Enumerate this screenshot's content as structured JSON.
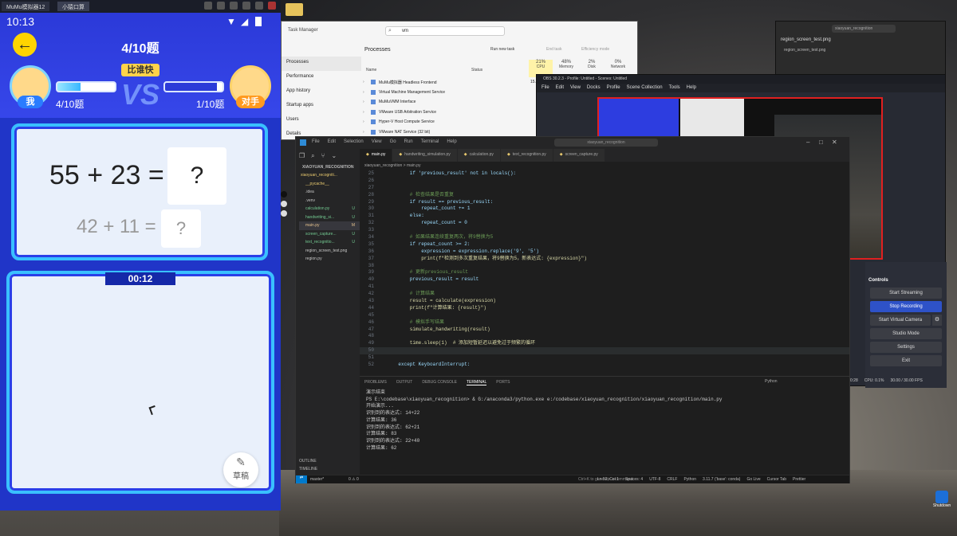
{
  "phone": {
    "window_tabs": [
      "MuMu模拟器12",
      "小猿口算"
    ],
    "time": "10:13",
    "progress_title": "4/10题",
    "mode_badge": "比谁快",
    "me": {
      "label": "我",
      "progress_text": "4/10题",
      "progress": 0.4
    },
    "opponent": {
      "label": "对手",
      "progress_text": "1/10题",
      "progress": 0.9
    },
    "current_question": {
      "expr": "55 + 23 =",
      "answer": "?"
    },
    "next_question": {
      "expr": "42 + 11 =",
      "answer": "?"
    },
    "timer": "00:12",
    "draft_label": "草稿"
  },
  "task_manager": {
    "title": "Task Manager",
    "search_value": "vm",
    "nav": [
      "Processes",
      "Performance",
      "App history",
      "Startup apps",
      "Users",
      "Details"
    ],
    "header": "Processes",
    "actions": [
      "Run new task",
      "End task",
      "Efficiency mode"
    ],
    "columns": {
      "name": "Name",
      "status": "Status",
      "cpu": "CPU",
      "memory": "Memory",
      "disk": "Disk",
      "network": "Network"
    },
    "usage": {
      "cpu": "21%",
      "memory": "48%",
      "disk": "2%",
      "network": "0%"
    },
    "rows": [
      {
        "name": "MuMu模拟器 Headless Frontend",
        "cpu": "15.0"
      },
      {
        "name": "Virtual Machine Management Service",
        "cpu": ""
      },
      {
        "name": "MuMuVMM Interface",
        "cpu": ""
      },
      {
        "name": "VMware USB Arbitration Service",
        "cpu": ""
      },
      {
        "name": "Hyper-V Host Compute Service",
        "cpu": ""
      },
      {
        "name": "VMware NAT Service (32 bit)",
        "cpu": ""
      }
    ]
  },
  "obs": {
    "title": "OBS 30.2.3 - Profile: Untitled - Scenes: Untitled",
    "menu": [
      "File",
      "Edit",
      "View",
      "Docks",
      "Profile",
      "Scene Collection",
      "Tools",
      "Help"
    ],
    "controls_header": "Controls",
    "buttons": [
      "Start Streaming",
      "Stop Recording",
      "Start Virtual Camera",
      "Studio Mode",
      "Settings",
      "Exit"
    ],
    "status": {
      "cpu": "CPU: 0.1%",
      "fps": "30.00 / 30.00 FPS",
      "time_prefix": "0:28"
    }
  },
  "image_viewer": {
    "search": "xiaoyuan_recognition",
    "tab": "region_screen_test.png",
    "subtab": "region_screen_test.png"
  },
  "vscode": {
    "menu": [
      "File",
      "Edit",
      "Selection",
      "View",
      "Go",
      "Run",
      "Terminal",
      "Help"
    ],
    "search": "xiaoyuan_recognition",
    "tabs": [
      "main.py",
      "handwriting_simulation.py",
      "calculation.py",
      "text_recognition.py",
      "screen_capture.py"
    ],
    "breadcrumb": "xiaoyuan_recognition > main.py",
    "explorer_title": "XIAOYUAN_RECOGNITION",
    "tree": [
      {
        "name": "xiaoyuan_recogniti...",
        "badge": "",
        "color": "#e8c96e"
      },
      {
        "name": "__pycache__",
        "badge": "",
        "color": "#e8c96e"
      },
      {
        "name": ".idea",
        "badge": "",
        "color": "#c8c8c8"
      },
      {
        "name": ".venv",
        "badge": "",
        "color": "#c8c8c8"
      },
      {
        "name": "calculation.py",
        "badge": "U",
        "color": "#73c991"
      },
      {
        "name": "handwriting_si...",
        "badge": "U",
        "color": "#73c991"
      },
      {
        "name": "main.py",
        "badge": "M",
        "color": "#e2c08d"
      },
      {
        "name": "screen_capture...",
        "badge": "U",
        "color": "#73c991"
      },
      {
        "name": "text_recognitio...",
        "badge": "U",
        "color": "#73c991"
      },
      {
        "name": "region_screen_test.png",
        "badge": "",
        "color": "#c8c8c8"
      },
      {
        "name": "region.py",
        "badge": "",
        "color": "#c8c8c8"
      }
    ],
    "code": [
      {
        "n": "25",
        "t": "        if 'previous_result' not in locals():"
      },
      {
        "n": "26",
        "t": ""
      },
      {
        "n": "27",
        "t": ""
      },
      {
        "n": "28",
        "t": "        # 检查结果是否重复"
      },
      {
        "n": "29",
        "t": "        if result == previous_result:"
      },
      {
        "n": "30",
        "t": "            repeat_count += 1"
      },
      {
        "n": "31",
        "t": "        else:"
      },
      {
        "n": "32",
        "t": "            repeat_count = 0"
      },
      {
        "n": "33",
        "t": ""
      },
      {
        "n": "34",
        "t": "        # 如果结果连续重复两次，将9替换为5"
      },
      {
        "n": "35",
        "t": "        if repeat_count >= 2:"
      },
      {
        "n": "36",
        "t": "            expression = expression.replace('9', '5')"
      },
      {
        "n": "37",
        "t": "            print(f\"检测到多次重复结果，将9替换为5，新表达式: {expression}\")"
      },
      {
        "n": "38",
        "t": ""
      },
      {
        "n": "39",
        "t": "        # 更新previous_result"
      },
      {
        "n": "40",
        "t": "        previous_result = result"
      },
      {
        "n": "41",
        "t": ""
      },
      {
        "n": "42",
        "t": "        # 计算结果"
      },
      {
        "n": "43",
        "t": "        result = calculate(expression)"
      },
      {
        "n": "44",
        "t": "        print(f\"计算结果: {result}\")"
      },
      {
        "n": "45",
        "t": ""
      },
      {
        "n": "46",
        "t": "        # 模拟手写结果"
      },
      {
        "n": "47",
        "t": "        simulate_handwriting(result)"
      },
      {
        "n": "48",
        "t": ""
      },
      {
        "n": "49",
        "t": "        time.sleep(1)  # 添加短暂延迟以避免过于频繁的循环"
      },
      {
        "n": "50",
        "t": ""
      },
      {
        "n": "51",
        "t": ""
      },
      {
        "n": "52",
        "t": "    except KeyboardInterrupt:"
      }
    ],
    "panel_tabs": [
      "PROBLEMS",
      "OUTPUT",
      "DEBUG CONSOLE",
      "TERMINAL",
      "PORTS"
    ],
    "terminal_profile": "Python",
    "terminal": [
      "演示结束",
      "PS E:\\codebase\\xiaoyuan_recognition> & G:/anaconda3/python.exe e:/codebase/xiaoyuan_recognition/xiaoyuan_recognition/main.py",
      "开始演示...",
      "识别到的表达式: 14+22",
      "计算结果: 36",
      "识别到的表达式: 62+21",
      "计算结果: 83",
      "识别到的表达式: 22+40",
      "计算结果: 62"
    ],
    "outline": "OUTLINE",
    "timeline": "TIMELINE",
    "statusbar": {
      "branch": "master*",
      "errors": "0 ⚠ 0",
      "warnings": "0",
      "position": "Ln 52, Col 1",
      "spaces": "Spaces: 4",
      "encoding": "UTF-8",
      "eol": "CRLF",
      "language": "Python",
      "interpreter": "3.11.7 ('base': conda)",
      "golive": "Go Live",
      "cursor_tab": "Cursor Tab",
      "prettier": "Prettier",
      "hint": "Ctrl+K to generate a command"
    }
  },
  "taskbar": {
    "shutdown_label": "Shutdown"
  },
  "colors": {
    "vscode_accent": "#007acc",
    "obs_stop": "#2e52c8",
    "phone_blue": "#2d3de0"
  }
}
